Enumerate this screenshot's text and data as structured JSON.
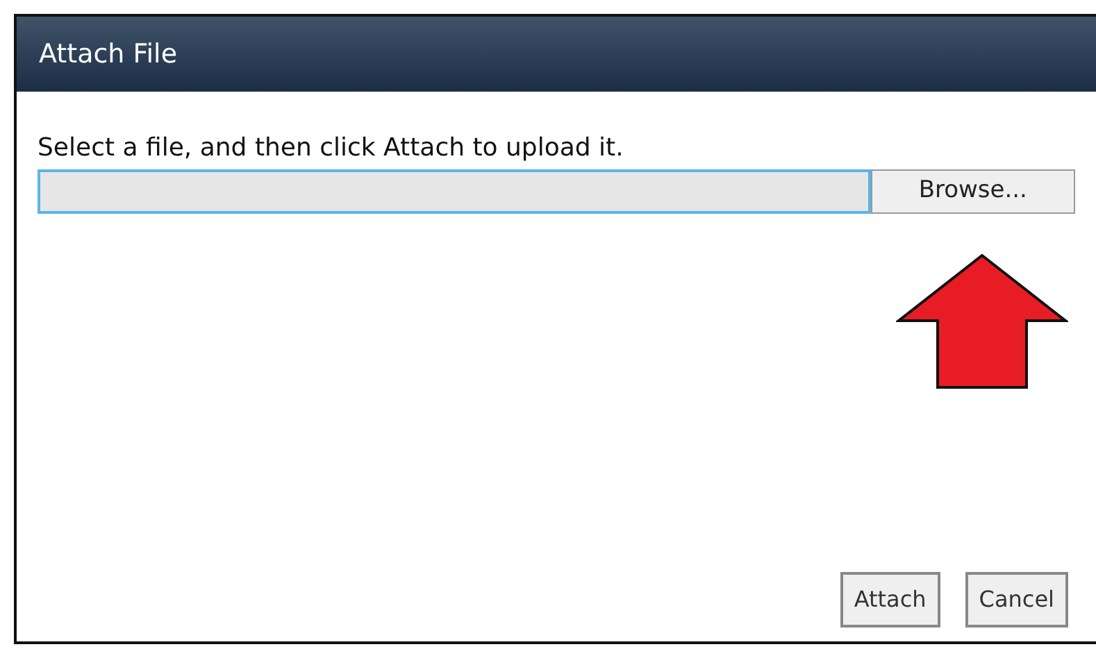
{
  "dialog": {
    "title": "Attach File",
    "instruction": "Select a file, and then click Attach to upload it.",
    "browse_button": "Browse...",
    "buttons": [
      "Attach",
      "Cancel"
    ]
  }
}
